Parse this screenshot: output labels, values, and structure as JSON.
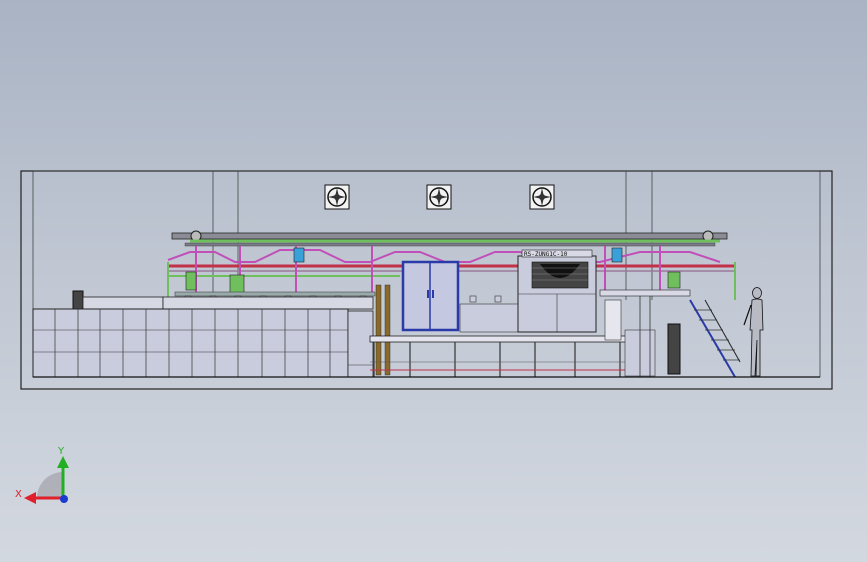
{
  "viewport": {
    "background_top": "#a9b3c4",
    "background_bottom": "#d3d8e0"
  },
  "model": {
    "fans": [
      "exhaust-fan",
      "exhaust-fan",
      "exhaust-fan"
    ],
    "equipment_plate_text": "RS-ZUNG1C-10",
    "colors": {
      "outline": "#1a1a1a",
      "panel_fill": "#c9ccdc",
      "blue_door": "#2a3aa8",
      "green_pipe": "#6fbf5f",
      "magenta_pipe": "#c04fb8",
      "red_pipe": "#c2304a",
      "brown_pipe": "#8a6a2a",
      "cyan_pump": "#3aa0d8"
    }
  },
  "triad": {
    "x_label": "X",
    "y_label": "Y",
    "x_color": "#e0202a",
    "y_color": "#22b022",
    "z_color": "#1a3ad0"
  }
}
